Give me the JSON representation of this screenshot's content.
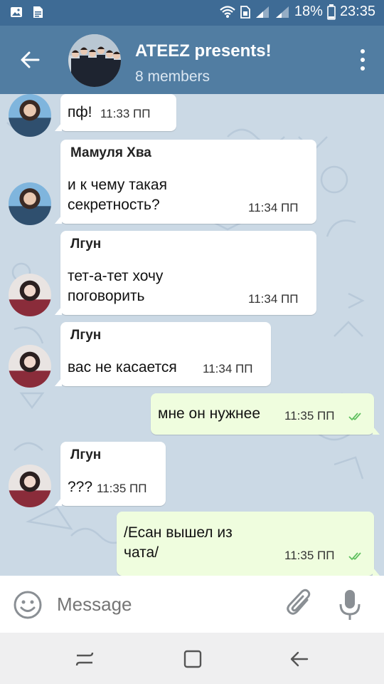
{
  "status_bar": {
    "battery": "18%",
    "time": "23:35"
  },
  "header": {
    "title": "ATEEZ presents!",
    "subtitle": "8 members"
  },
  "messages": [
    {
      "type": "incoming",
      "text": "пф!",
      "time": "11:33 ПП"
    },
    {
      "type": "incoming",
      "sender": "Мамуля Хва",
      "text_lines": [
        "и к чему такая",
        "секретность?"
      ],
      "time": "11:34 ПП"
    },
    {
      "type": "incoming",
      "sender": "Лгун",
      "text_lines": [
        "тет-а-тет хочу",
        "поговорить"
      ],
      "time": "11:34 ПП"
    },
    {
      "type": "incoming",
      "sender": "Лгун",
      "text": "вас не касается",
      "time": "11:34 ПП"
    },
    {
      "type": "outgoing",
      "text": "мне он нужнее",
      "time": "11:35 ПП"
    },
    {
      "type": "incoming",
      "sender": "Лгун",
      "text": "???",
      "time": "11:35 ПП"
    },
    {
      "type": "outgoing",
      "text_lines": [
        "/Есан вышел из",
        "чата/"
      ],
      "time": "11:35 ПП"
    }
  ],
  "input": {
    "placeholder": "Message"
  },
  "colors": {
    "header": "#517da2",
    "status": "#3e6b95",
    "outgoing_bubble": "#effdde",
    "check": "#5fc05f"
  }
}
